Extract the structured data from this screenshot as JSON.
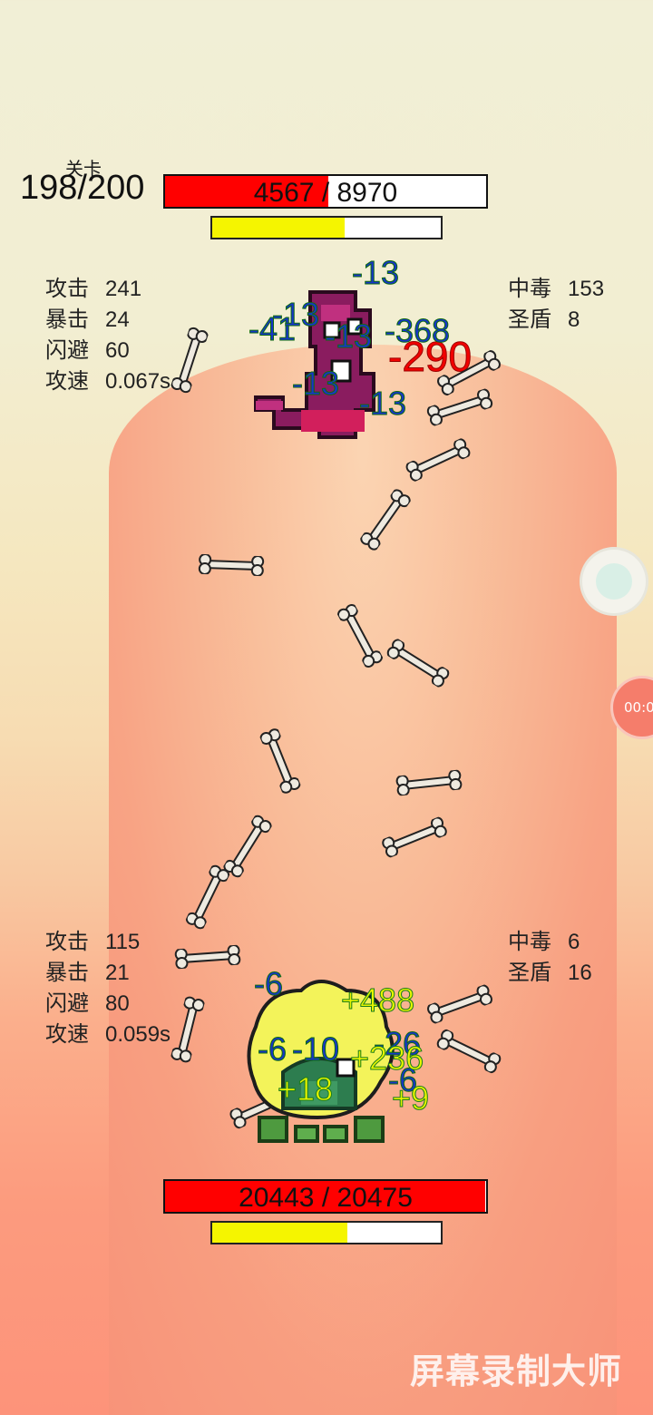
{
  "level": {
    "label": "关卡",
    "value": "198/200"
  },
  "enemy": {
    "hp_text": "4567 / 8970",
    "hp_fraction": 0.509,
    "energy_fraction": 0.58,
    "stats_left": [
      {
        "name": "攻击",
        "value": "241"
      },
      {
        "name": "暴击",
        "value": "24"
      },
      {
        "name": "闪避",
        "value": "60"
      },
      {
        "name": "攻速",
        "value": "0.067s"
      }
    ],
    "stats_right": [
      {
        "name": "中毒",
        "value": "153"
      },
      {
        "name": "圣盾",
        "value": "8"
      }
    ]
  },
  "player": {
    "hp_text": "20443 / 20475",
    "hp_fraction": 0.998,
    "energy_fraction": 0.59,
    "stats_left": [
      {
        "name": "攻击",
        "value": "115"
      },
      {
        "name": "暴击",
        "value": "21"
      },
      {
        "name": "闪避",
        "value": "80"
      },
      {
        "name": "攻速",
        "value": "0.059s"
      }
    ],
    "stats_right": [
      {
        "name": "中毒",
        "value": "6"
      },
      {
        "name": "圣盾",
        "value": "16"
      }
    ]
  },
  "damage_numbers_enemy": [
    "-13",
    "-41",
    "-13",
    "-13",
    "-290",
    "-13",
    "-13",
    "-368"
  ],
  "damage_numbers_player": [
    "-6",
    "-6",
    "-10",
    "-26",
    "-6",
    "+488",
    "+18",
    "+9",
    "+236"
  ],
  "timer_text": "00:0",
  "watermark": "屏幕录制大师",
  "colors": {
    "hp_fill": "#ff0000",
    "energy_fill": "#f5f500",
    "damage": "#1734c9",
    "crit": "#f20000",
    "heal": "#e8f500"
  },
  "icons": [
    "bone-icon",
    "recorder-icon"
  ]
}
